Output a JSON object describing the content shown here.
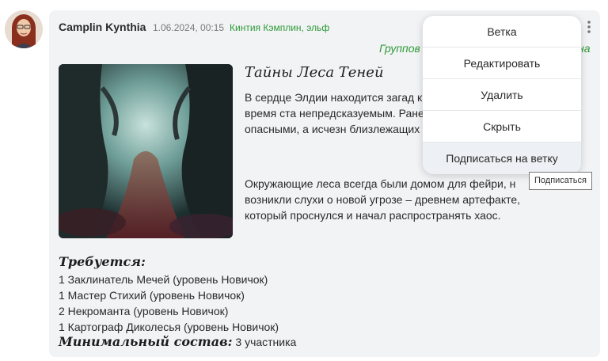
{
  "post": {
    "author": "Camplin Kynthia",
    "date": "1.06.2024, 00:15",
    "character": "Кинтия Кэмплин, эльф",
    "group_start": "Группов",
    "group_end": "на",
    "title": "Тайны Леса Теней",
    "paragraph1": "В сердце Элдии находится загад который за последнее время ста непредсказуемым. Ранее безопа смертельно опасными, а исчезн близлежащих деревень участил",
    "paragraph2": "Окружающие леса всегда были домом для фейри, н возникли слухи о новой угрозе – древнем артефакте, который проснулся и начал распространять хаос.",
    "requirements_title": "Требуется:",
    "requirements": [
      "1 Заклинатель Мечей (уровень Новичок)",
      "1 Мастер Стихий (уровень Новичок)",
      "2 Некроманта (уровень Новичок)",
      "1 Картограф Диколесья (уровень Новичок)"
    ],
    "min_label": "Минимальный состав:",
    "min_value": "3 участника"
  },
  "menu": {
    "items": [
      "Ветка",
      "Редактировать",
      "Удалить",
      "Скрыть",
      "Подписаться на ветку"
    ]
  },
  "tooltip": "Подписаться",
  "colors": {
    "accent_green": "#2e9a38",
    "card_bg": "#f2f3f5"
  },
  "icons": {
    "more": "kebab-vertical-icon"
  }
}
